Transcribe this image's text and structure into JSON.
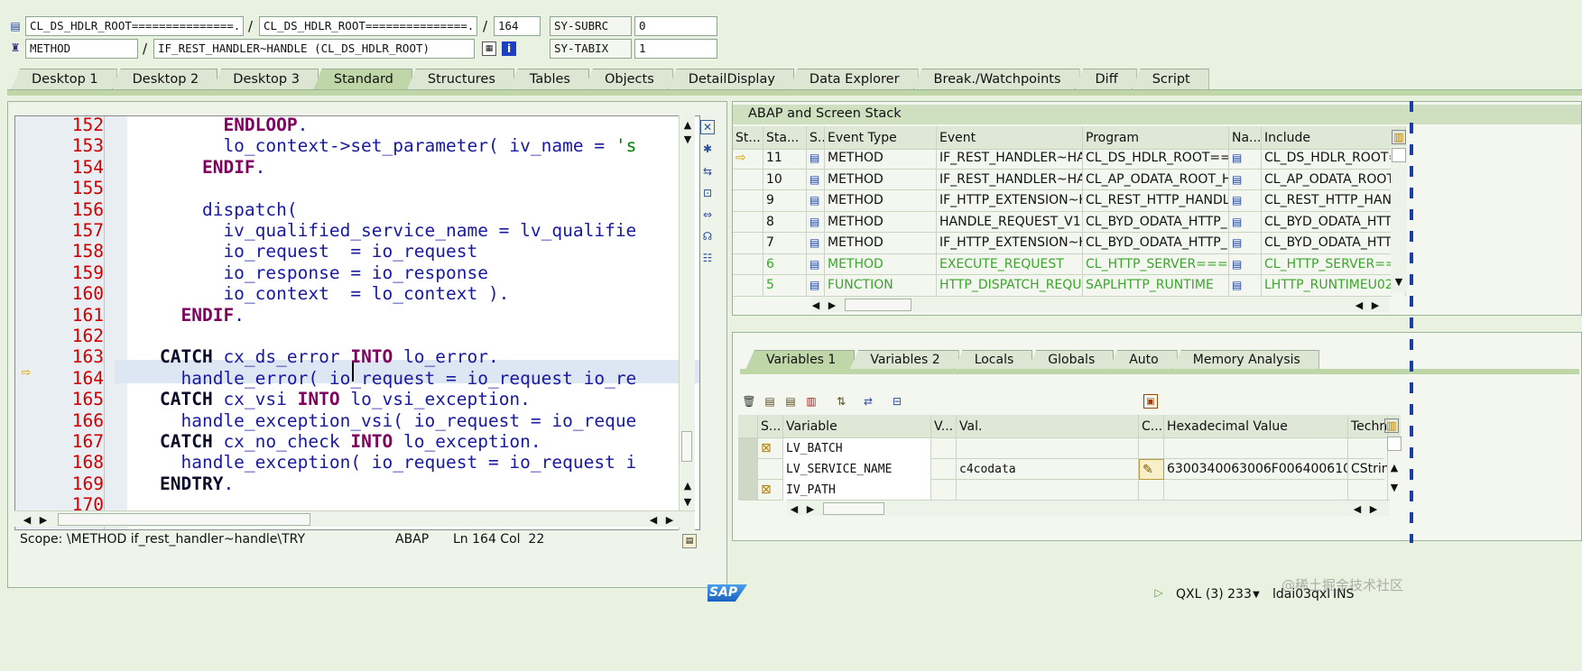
{
  "header": {
    "program1": "CL_DS_HDLR_ROOT===============...",
    "program2": "CL_DS_HDLR_ROOT===============...",
    "line": "164",
    "sy_subrc_label": "SY-SUBRC",
    "sy_subrc_value": "0",
    "type": "METHOD",
    "event": "IF_REST_HANDLER~HANDLE (CL_DS_HDLR_ROOT)",
    "sy_tabix_label": "SY-TABIX",
    "sy_tabix_value": "1",
    "slash": "/"
  },
  "tabs": [
    "Desktop 1",
    "Desktop 2",
    "Desktop 3",
    "Standard",
    "Structures",
    "Tables",
    "Objects",
    "DetailDisplay",
    "Data Explorer",
    "Break./Watchpoints",
    "Diff",
    "Script"
  ],
  "code": {
    "lines": [
      {
        "no": "152",
        "text": "      ENDLOOP."
      },
      {
        "no": "153",
        "text": "      lo_context->set_parameter( iv_name = 's"
      },
      {
        "no": "154",
        "text": "    ENDIF."
      },
      {
        "no": "155",
        "text": ""
      },
      {
        "no": "156",
        "text": "    dispatch("
      },
      {
        "no": "157",
        "text": "      iv_qualified_service_name = lv_qualifie"
      },
      {
        "no": "158",
        "text": "      io_request  = io_request"
      },
      {
        "no": "159",
        "text": "      io_response = io_response"
      },
      {
        "no": "160",
        "text": "      io_context  = lo_context )."
      },
      {
        "no": "161",
        "text": "  ENDIF."
      },
      {
        "no": "162",
        "text": ""
      },
      {
        "no": "163",
        "text": "CATCH cx_ds_error INTO lo_error."
      },
      {
        "no": "164",
        "text": "  handle_error( io_request = io_request io_re"
      },
      {
        "no": "165",
        "text": "CATCH cx_vsi INTO lo_vsi_exception."
      },
      {
        "no": "166",
        "text": "  handle_exception_vsi( io_request = io_reque"
      },
      {
        "no": "167",
        "text": "CATCH cx_no_check INTO lo_exception."
      },
      {
        "no": "168",
        "text": "  handle_exception( io_request = io_request i"
      },
      {
        "no": "169",
        "text": "ENDTRY."
      },
      {
        "no": "170",
        "text": ""
      }
    ]
  },
  "statusbar": {
    "scope": "Scope: \\METHOD if_rest_handler~handle\\TRY",
    "language": "ABAP",
    "position": "Ln 164 Col  22"
  },
  "stack": {
    "title": "ABAP and Screen Stack",
    "columns": [
      "St...",
      "Sta...",
      "S..",
      "Event Type",
      "Event",
      "Program",
      "Na...",
      "Include"
    ],
    "rows": [
      {
        "sta": "11",
        "type": "METHOD",
        "event": "IF_REST_HANDLER~HAN...",
        "program": "CL_DS_HDLR_ROOT===...",
        "include": "CL_DS_HDLR_ROOT=="
      },
      {
        "sta": "10",
        "type": "METHOD",
        "event": "IF_REST_HANDLER~HAN...",
        "program": "CL_AP_ODATA_ROOT_H...",
        "include": "CL_AP_ODATA_ROOT_"
      },
      {
        "sta": "9",
        "type": "METHOD",
        "event": "IF_HTTP_EXTENSION~H...",
        "program": "CL_REST_HTTP_HANDL...",
        "include": "CL_REST_HTTP_HAND"
      },
      {
        "sta": "8",
        "type": "METHOD",
        "event": "HANDLE_REQUEST_V1",
        "program": "CL_BYD_ODATA_HTTP_...",
        "include": "CL_BYD_ODATA_HTTF"
      },
      {
        "sta": "7",
        "type": "METHOD",
        "event": "IF_HTTP_EXTENSION~H...",
        "program": "CL_BYD_ODATA_HTTP_...",
        "include": "CL_BYD_ODATA_HTTF"
      },
      {
        "sta": "6",
        "type": "METHOD",
        "event": "EXECUTE_REQUEST",
        "program": "CL_HTTP_SERVER====...",
        "include": "CL_HTTP_SERVER==="
      },
      {
        "sta": "5",
        "type": "FUNCTION",
        "event": "HTTP_DISPATCH_REQU...",
        "program": "SAPLHTTP_RUNTIME",
        "include": "LHTTP_RUNTIMEU02"
      }
    ]
  },
  "vartabs": [
    "Variables 1",
    "Variables 2",
    "Locals",
    "Globals",
    "Auto",
    "Memory Analysis"
  ],
  "variables": {
    "columns": [
      "S...",
      "Variable",
      "V...",
      "Val.",
      "C...",
      "Hexadecimal Value",
      "Techn"
    ],
    "rows": [
      {
        "name": "LV_BATCH",
        "value": "",
        "hex": "",
        "tech": ""
      },
      {
        "name": "LV_SERVICE_NAME",
        "value": "c4codata",
        "hex": "6300340063006F0064006100...",
        "tech": "CString"
      },
      {
        "name": "IV_PATH",
        "value": "",
        "hex": "",
        "tech": ""
      }
    ]
  },
  "footer": {
    "logo": "SAP",
    "system": "QXL (3) 233",
    "user": "ldai03qxl",
    "mode": "INS",
    "watermark": "@稀土掘金技术社区"
  }
}
